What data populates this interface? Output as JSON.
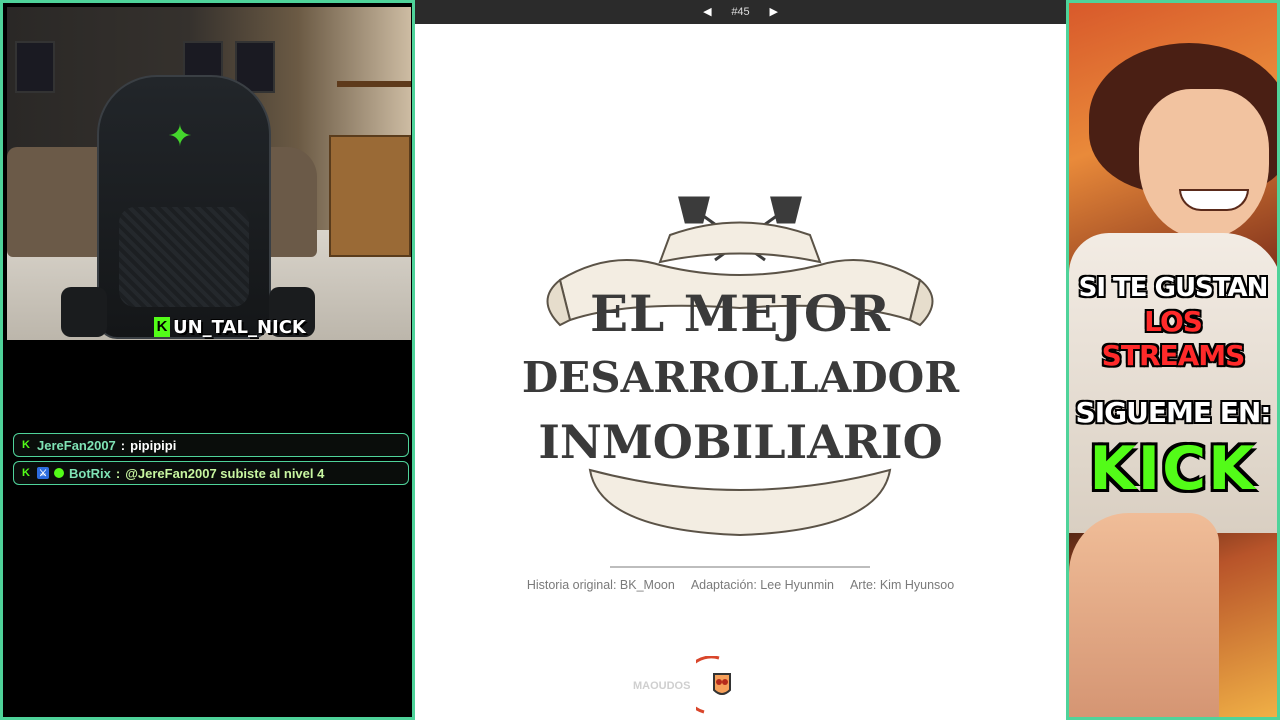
{
  "webcam": {
    "streamer_name": "UN_TAL_NICK",
    "kick_badge": "K"
  },
  "chat": {
    "messages": [
      {
        "user": "JereFan2007",
        "separator": ":",
        "text": "pipipipi",
        "badges": [
          "kick-icon"
        ]
      },
      {
        "user": "BotRix",
        "separator": ":",
        "text": "@JereFan2007 subiste al nivel 4",
        "badges": [
          "kick-icon",
          "mod-icon",
          "bot-icon"
        ]
      }
    ]
  },
  "reader": {
    "page_indicator": "#45",
    "prev_icon": "◀",
    "next_icon": "▶",
    "title_line1": "EL MEJOR",
    "title_line2": "DESARROLLADOR",
    "title_line3": "INMOBILIARIO",
    "credits": {
      "original": "Historia original: BK_Moon",
      "adaptation": "Adaptación: Lee Hyunmin",
      "art": "Arte: Kim Hyunsoo"
    },
    "watermark": "MAOUDOS"
  },
  "promo": {
    "line1": "SI TE GUSTAN",
    "line2": "LOS STREAMS",
    "line3": "SIGUEME EN:",
    "line4": "KICK"
  },
  "colors": {
    "accent_border": "#4fd39a",
    "kick_green": "#53fc18",
    "promo_red": "#ff2a2a"
  }
}
